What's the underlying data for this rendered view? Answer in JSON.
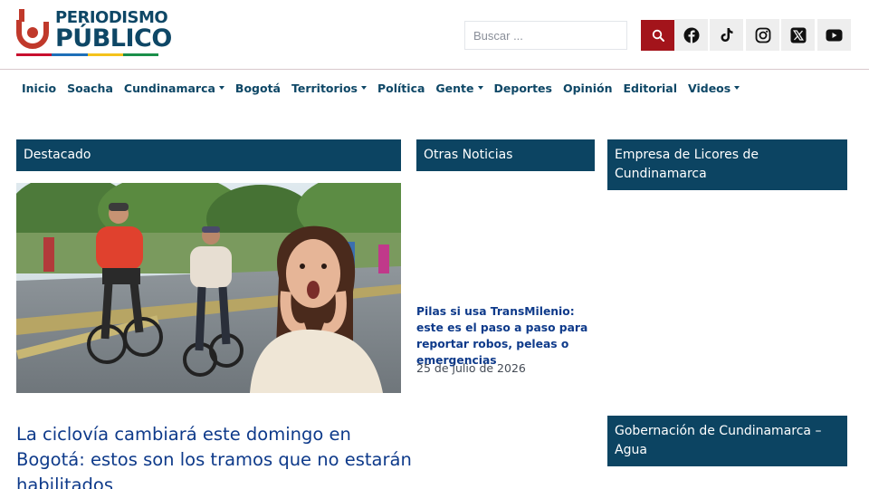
{
  "brand": {
    "line1": "PERIODISMO",
    "line2": "PÚBLICO",
    "colors": {
      "primary": "#0e4766",
      "accent": "#a3141b",
      "bar": [
        "#c8102e",
        "#1e6fb8",
        "#f4c21b",
        "#1a8f4a"
      ]
    }
  },
  "header": {
    "search": {
      "placeholder": "Buscar ...",
      "button_icon": "search-icon"
    },
    "social": [
      "facebook-icon",
      "tiktok-icon",
      "instagram-icon",
      "x-icon",
      "youtube-icon"
    ]
  },
  "nav": {
    "items": [
      {
        "label": "Inicio",
        "dropdown": false
      },
      {
        "label": "Soacha",
        "dropdown": false
      },
      {
        "label": "Cundinamarca",
        "dropdown": true
      },
      {
        "label": "Bogotá",
        "dropdown": false
      },
      {
        "label": "Territorios",
        "dropdown": true
      },
      {
        "label": "Política",
        "dropdown": false
      },
      {
        "label": "Gente",
        "dropdown": true
      },
      {
        "label": "Deportes",
        "dropdown": false
      },
      {
        "label": "Opinión",
        "dropdown": false
      },
      {
        "label": "Editorial",
        "dropdown": false
      },
      {
        "label": "Videos",
        "dropdown": true
      }
    ]
  },
  "featured": {
    "heading": "Destacado",
    "title": "La ciclovía cambiará este domingo en Bogotá: estos son los tramos que no estarán habilitados"
  },
  "other_news": {
    "heading": "Otras Noticias",
    "article": {
      "title": "Pilas si usa TransMilenio: este es el paso a paso para reportar robos, peleas o emergencias",
      "date": "25 de julio de 2026"
    }
  },
  "sidebar": {
    "widget1": "Empresa de Licores de Cundinamarca",
    "widget2": "Gobernación de Cundinamarca – Agua"
  }
}
